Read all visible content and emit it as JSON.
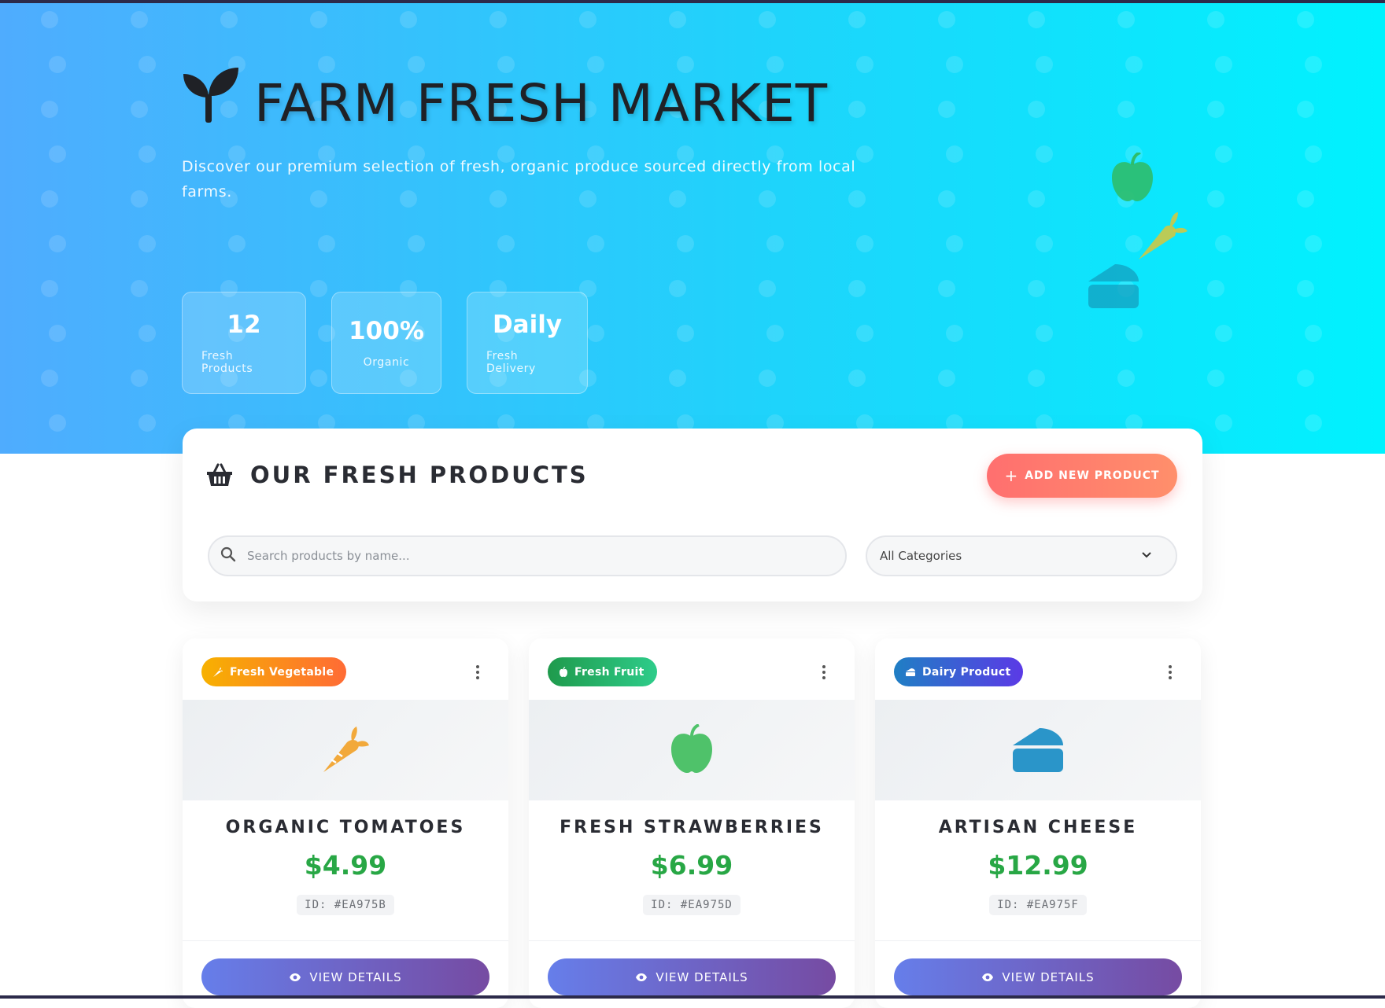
{
  "hero": {
    "title": "FARM FRESH MARKET",
    "subtitle": "Discover our premium selection of fresh, organic produce sourced directly from local farms.",
    "stats": [
      {
        "value": "12",
        "label": "Fresh Products"
      },
      {
        "value": "100%",
        "label": "Organic"
      },
      {
        "value": "Daily",
        "label": "Fresh Delivery"
      }
    ],
    "decor_icons": [
      "apple-icon",
      "carrot-icon",
      "cheese-icon"
    ]
  },
  "panel": {
    "title": "OUR FRESH PRODUCTS",
    "add_button": "ADD NEW PRODUCT",
    "search_placeholder": "Search products by name...",
    "category_selected": "All Categories"
  },
  "products": [
    {
      "badge": "Fresh Vegetable",
      "badge_icon": "carrot-icon",
      "name": "ORGANIC TOMATOES",
      "price": "$4.99",
      "id": "ID: #EA975B",
      "view_label": "VIEW DETAILS",
      "image_icon": "carrot-icon"
    },
    {
      "badge": "Fresh Fruit",
      "badge_icon": "apple-icon",
      "name": "FRESH STRAWBERRIES",
      "price": "$6.99",
      "id": "ID: #EA975D",
      "view_label": "VIEW DETAILS",
      "image_icon": "apple-icon"
    },
    {
      "badge": "Dairy Product",
      "badge_icon": "cheese-icon",
      "name": "ARTISAN CHEESE",
      "price": "$12.99",
      "id": "ID: #EA975F",
      "view_label": "VIEW DETAILS",
      "image_icon": "cheese-icon"
    }
  ],
  "colors": {
    "hero_gradient": [
      "#4facfe",
      "#00f2fe"
    ],
    "add_button": "#ff7a6c",
    "price": "#28a745",
    "view_button": [
      "#667eea",
      "#764ba2"
    ],
    "badge_vegetable": [
      "#f7b100",
      "#ff6b35"
    ],
    "badge_fruit": [
      "#1f9a4c",
      "#2ecc8a"
    ],
    "badge_dairy": [
      "#1f7fc4",
      "#5b3ae6"
    ]
  }
}
